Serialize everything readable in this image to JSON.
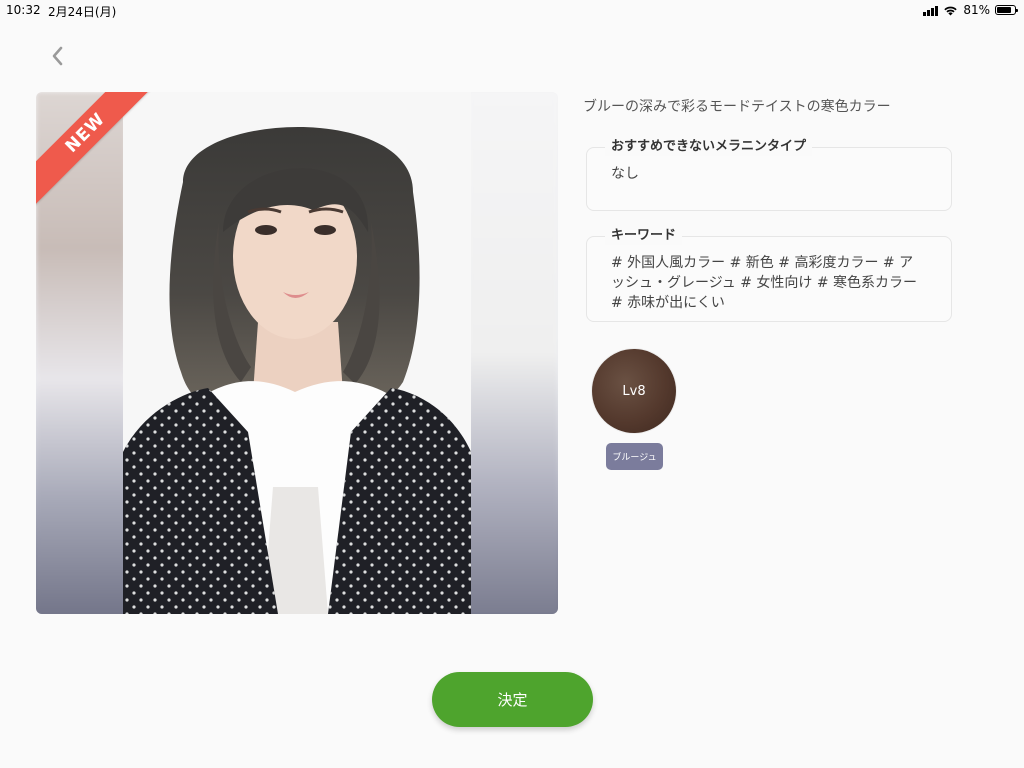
{
  "status_bar": {
    "time": "10:32",
    "date": "2月24日(月)",
    "battery": "81%",
    "battery_level": 0.81
  },
  "badge": {
    "label": "NEW",
    "color": "#ef5a4c"
  },
  "description": "ブルーの深みで彩るモードテイストの寒色カラー",
  "not_recommended": {
    "title": "おすすめできないメラニンタイプ",
    "value": "なし"
  },
  "keywords": {
    "title": "キーワード",
    "text": "# 外国人風カラー # 新色 # 高彩度カラー # アッシュ・グレージュ # 女性向け # 寒色系カラー # 赤味が出にくい"
  },
  "color_swatch": {
    "level": "Lv8",
    "tag": "ブルージュ",
    "swatch_color": "#54392d",
    "tag_color": "#7b7c9c"
  },
  "confirm_button": {
    "label": "決定",
    "color": "#4ea42d"
  }
}
